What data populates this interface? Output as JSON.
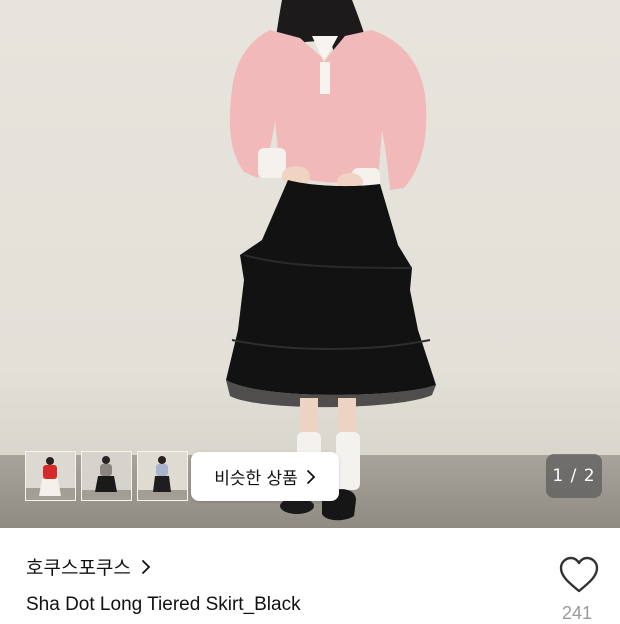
{
  "gallery": {
    "similar_label": "비슷한 상품",
    "counter": "1 / 2",
    "thumbnails": [
      "thumb-red-top",
      "thumb-black-skirt",
      "thumb-blue-top"
    ]
  },
  "product": {
    "brand": "호쿠스포쿠스",
    "name": "Sha Dot Long Tiered Skirt_Black",
    "likes": "241"
  },
  "icons": {
    "brand_arrow": "chevron-right-icon",
    "similar_arrow": "chevron-right-icon",
    "like": "heart-icon"
  }
}
